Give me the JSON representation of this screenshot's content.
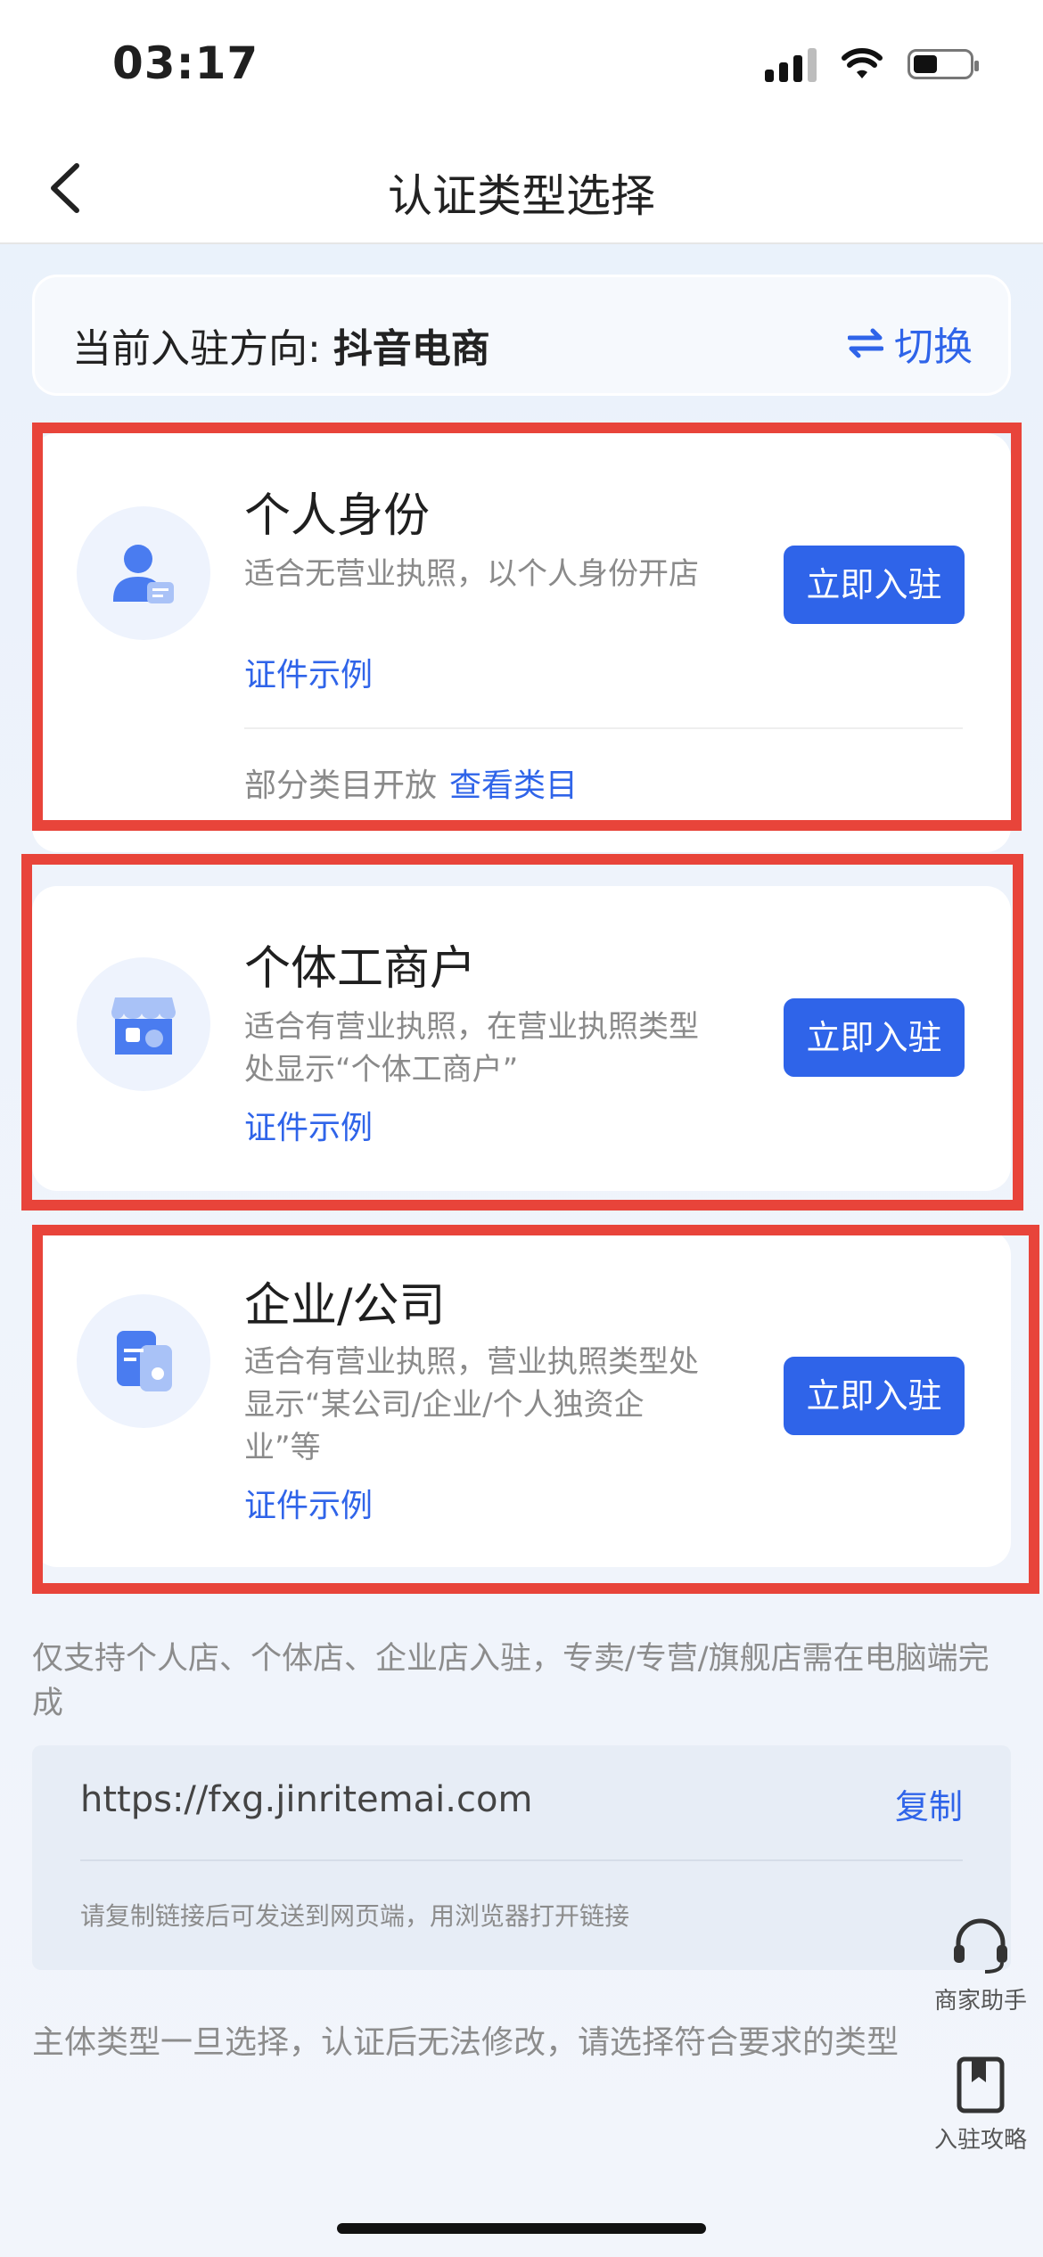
{
  "status_bar": {
    "time": "03:17"
  },
  "nav": {
    "title": "认证类型选择"
  },
  "direction": {
    "label": "当前入驻方向: ",
    "value": "抖音电商",
    "switch_label": "切换"
  },
  "cards": [
    {
      "title": "个人身份",
      "desc": "适合无营业执照，以个人身份开店",
      "example_link": "证件示例",
      "button": "立即入驻",
      "footer_text": "部分类目开放",
      "footer_link": "查看类目",
      "icon": "person-icon"
    },
    {
      "title": "个体工商户",
      "desc": "适合有营业执照，在营业执照类型处显示“个体工商户”",
      "example_link": "证件示例",
      "button": "立即入驻",
      "icon": "shop-icon"
    },
    {
      "title": "企业/公司",
      "desc": "适合有营业执照，营业执照类型处显示“某公司/企业/个人独资企业”等",
      "example_link": "证件示例",
      "button": "立即入驻",
      "icon": "company-doc-icon"
    }
  ],
  "notes": {
    "support": "仅支持个人店、个体店、企业店入驻，专卖/专营/旗舰店需在电脑端完成",
    "url": "https://fxg.jinritemai.com",
    "copy": "复制",
    "url_hint": "请复制链接后可发送到网页端，用浏览器打开链接",
    "warning": "主体类型一旦选择，认证后无法修改，请选择符合要求的类型"
  },
  "floating": {
    "assistant": "商家助手",
    "guide": "入驻攻略"
  },
  "colors": {
    "accent": "#2f64e9",
    "highlight_box": "#e8443a"
  }
}
